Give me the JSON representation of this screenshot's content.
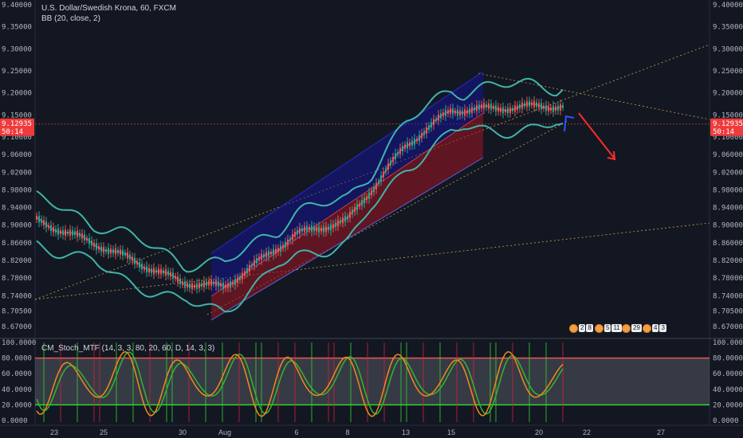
{
  "header": {
    "symbol_line": "U.S. Dollar/Swedish Krona, 60, FXCM",
    "indicator_line": "BB (20, close, 2)"
  },
  "lower_pane": {
    "title": "CM_Stoch_MTF (14, 3, 3, 80, 20, 60, D, 14, 3, 3)"
  },
  "price_tag": {
    "value": "9.12935",
    "countdown": "50:14",
    "color": "#ef3b3b"
  },
  "badges": [
    {
      "icon": "event-flag-icon",
      "values": [
        "2",
        "8"
      ]
    },
    {
      "icon": "event-flag-icon",
      "values": [
        "5",
        "11"
      ]
    },
    {
      "icon": "event-flag-icon",
      "values": [
        "29"
      ]
    },
    {
      "icon": "event-flag-icon",
      "values": [
        "4",
        "3"
      ]
    }
  ],
  "colors": {
    "background": "#131722",
    "bb_band": "#3fb5a8",
    "bb_basis": "#b64a3c",
    "channel_upper": "#1a1a8a",
    "channel_lower": "#8a1a25",
    "stoch_k": "#ef8a1a",
    "stoch_d": "#33b533",
    "stoch_fill": "#787b86"
  },
  "chart_data": [
    {
      "type": "line",
      "title": "U.S. Dollar/Swedish Krona, 60, FXCM",
      "y_ticks": [
        "9.40000",
        "9.35000",
        "9.30000",
        "9.25000",
        "9.20000",
        "9.15000",
        "9.10000",
        "9.06000",
        "9.02000",
        "8.98000",
        "8.94000",
        "8.90000",
        "8.86000",
        "8.82000",
        "8.78000",
        "8.74000",
        "8.70500",
        "8.67000"
      ],
      "x_ticks": [
        "23",
        "25",
        "30",
        "Aug",
        "6",
        "8",
        "13",
        "15",
        "20",
        "22",
        "27"
      ],
      "ylim": [
        8.67,
        9.4
      ],
      "series": [
        {
          "name": "BB (20, close, 2)",
          "x": [
            "23",
            "25",
            "30",
            "Aug",
            "6",
            "8",
            "13",
            "15",
            "20"
          ],
          "values": [
            8.895,
            8.85,
            8.77,
            8.76,
            8.88,
            8.91,
            9.08,
            9.16,
            9.17
          ]
        }
      ],
      "last_price": 9.12935
    },
    {
      "type": "line",
      "title": "CM_Stoch_MTF (14, 3, 3, 80, 20, 60, D, 14, 3, 3)",
      "y_ticks": [
        "100.0000",
        "80.0000",
        "60.0000",
        "40.0000",
        "20.0000",
        "0.0000"
      ],
      "ylim": [
        0,
        100
      ],
      "levels": [
        80,
        20
      ]
    }
  ]
}
